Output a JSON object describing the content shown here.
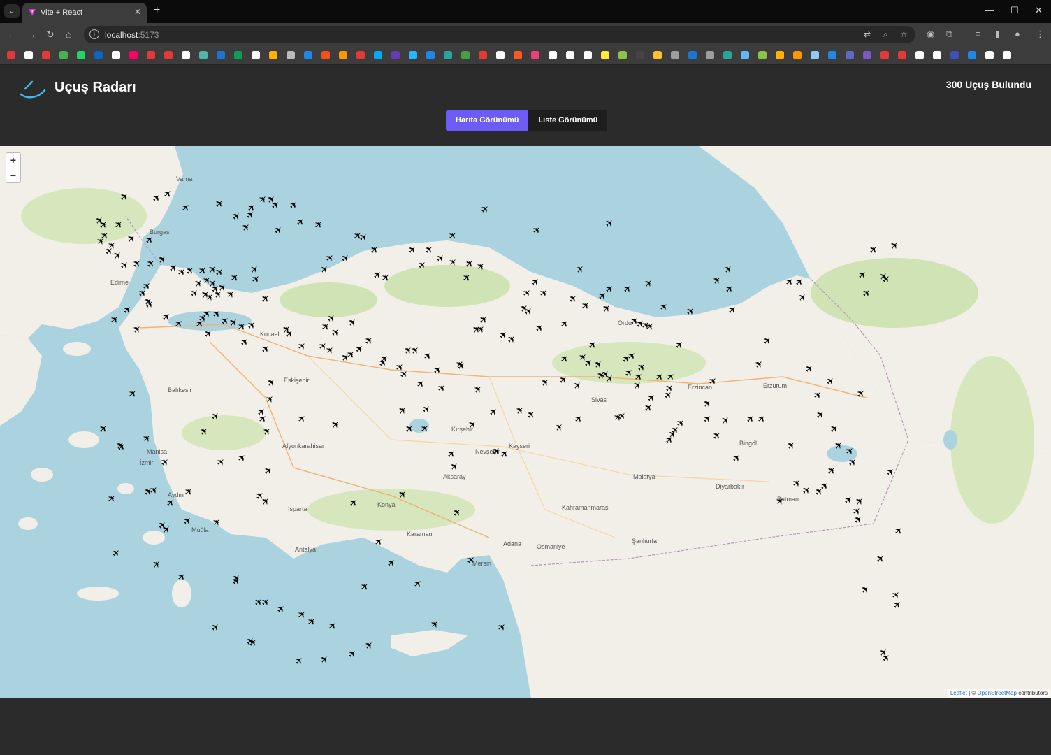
{
  "browser": {
    "tab_title": "Vite + React",
    "url_host": "localhost",
    "url_port": ":5173"
  },
  "app": {
    "title": "Uçuş Radarı",
    "flight_count": "300 Uçuş Bulundu",
    "views": [
      {
        "label": "Harita Görünümü",
        "active": true
      },
      {
        "label": "Liste Görünümü",
        "active": false
      }
    ]
  },
  "map": {
    "zoom_in": "+",
    "zoom_out": "−",
    "attribution_leaflet": "Leaflet",
    "attribution_sep": " | © ",
    "attribution_osm": "OpenStreetMap",
    "attribution_tail": " contributors",
    "labels": [
      {
        "name": "Varna"
      },
      {
        "name": "Burgas"
      },
      {
        "name": "Edirne"
      },
      {
        "name": "Kocaeli"
      },
      {
        "name": "Eskişehir"
      },
      {
        "name": "Balıkesir"
      },
      {
        "name": "Manisa"
      },
      {
        "name": "İzmir"
      },
      {
        "name": "Aydın"
      },
      {
        "name": "Muğla"
      },
      {
        "name": "Isparta"
      },
      {
        "name": "Antalya"
      },
      {
        "name": "Afyonkarahisar"
      },
      {
        "name": "Konya"
      },
      {
        "name": "Karaman"
      },
      {
        "name": "Kayseri"
      },
      {
        "name": "Aksaray"
      },
      {
        "name": "Nevşehir"
      },
      {
        "name": "Kırşehir"
      },
      {
        "name": "Adana"
      },
      {
        "name": "Osmaniye"
      },
      {
        "name": "Kahramanmaraş"
      },
      {
        "name": "Malatya"
      },
      {
        "name": "Şanlıurfa"
      },
      {
        "name": "Diyarbakır"
      },
      {
        "name": "Batman"
      },
      {
        "name": "Erzurum"
      },
      {
        "name": "Erzincan"
      },
      {
        "name": "Bingöl"
      },
      {
        "name": "Ordu"
      },
      {
        "name": "Sivas"
      },
      {
        "name": "Mersin"
      }
    ]
  }
}
